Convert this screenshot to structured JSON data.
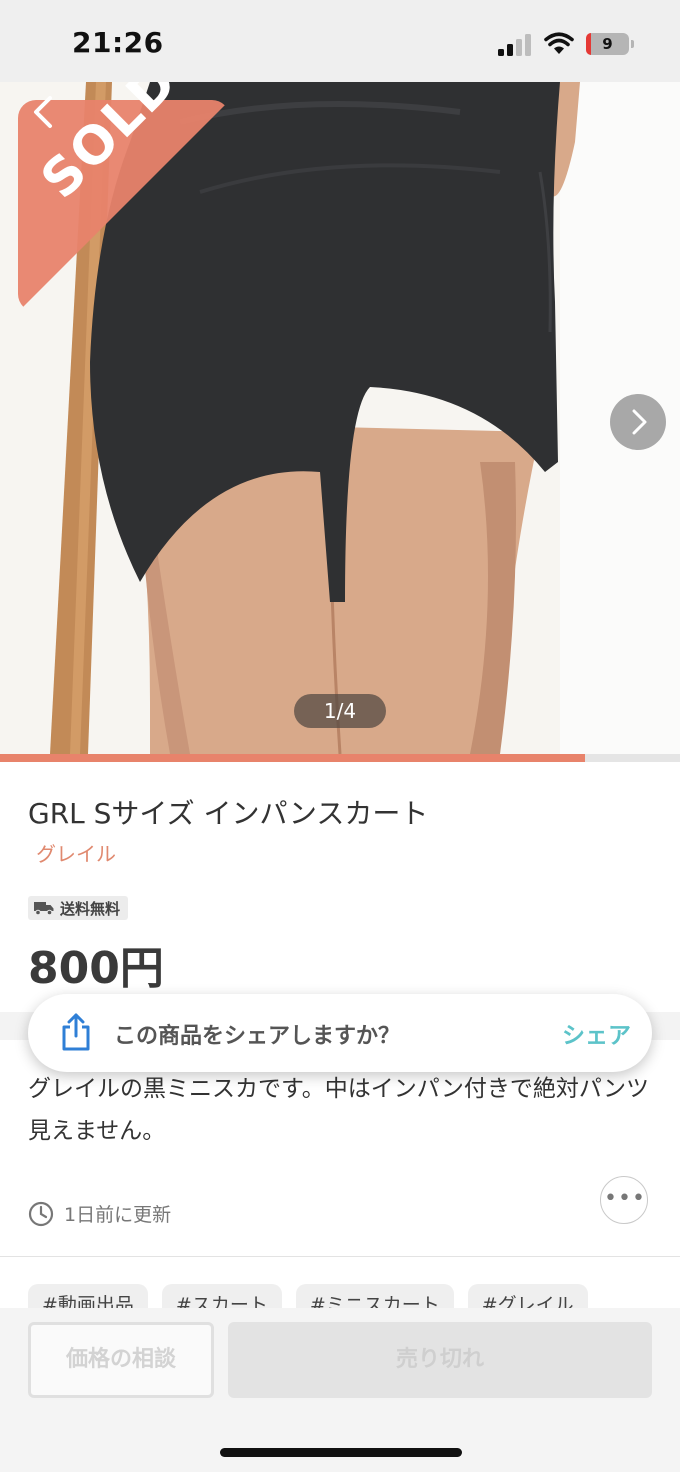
{
  "status_bar": {
    "time": "21:26",
    "battery_level": "9",
    "icons": [
      "cellular-signal-icon",
      "wifi-icon",
      "battery-icon"
    ]
  },
  "gallery": {
    "sold_label": "SOLD",
    "page_indicator": "1/4",
    "current_image": 1,
    "image_count": 4,
    "progress_fraction": 0.86,
    "icons": [
      "back-chevron-icon",
      "next-chevron-icon"
    ]
  },
  "product": {
    "title": "GRL Sサイズ インパンスカート",
    "brand": "グレイル",
    "shipping_badge": "送料無料",
    "price": "800円"
  },
  "share_toast": {
    "question": "この商品をシェアしますか？",
    "action": "シェア"
  },
  "description": {
    "text": "グレイルの黒ミニスカです。中はインパン付きで絶対パンツ見えません。",
    "updated": "1日前に更新"
  },
  "tags": [
    "#動画出品",
    "#スカート",
    "#ミニスカート",
    "#グレイル"
  ],
  "bottom_bar": {
    "consult_label": "価格の相談",
    "soldout_label": "売り切れ"
  },
  "colors": {
    "accent": "#e8836b",
    "share_action": "#5cc3c9",
    "brand_text": "#e0896f"
  }
}
